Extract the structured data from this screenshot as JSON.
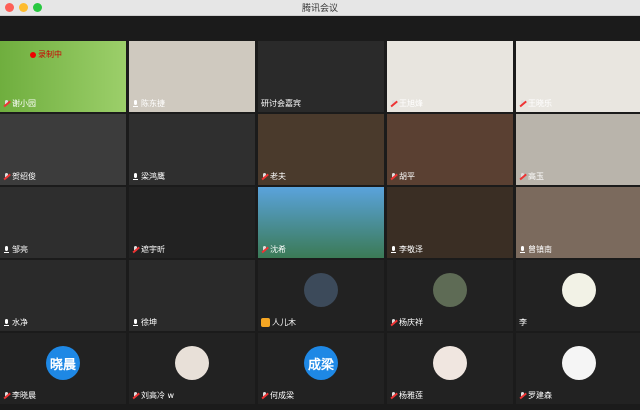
{
  "window": {
    "title": "腾讯会议"
  },
  "recording": {
    "label": "录制中"
  },
  "participants": [
    {
      "name": "谢小园",
      "mic": "off",
      "badge": false
    },
    {
      "name": "陈东捷",
      "mic": "on",
      "badge": false
    },
    {
      "name": "研讨会嘉宾",
      "mic": "none",
      "badge": false
    },
    {
      "name": "王旭烽",
      "mic": "off",
      "badge": false
    },
    {
      "name": "王晓乐",
      "mic": "off",
      "badge": false
    },
    {
      "name": "贺绍俊",
      "mic": "off",
      "badge": false
    },
    {
      "name": "梁鸿鹰",
      "mic": "on",
      "badge": false
    },
    {
      "name": "老夫",
      "mic": "off",
      "badge": false
    },
    {
      "name": "胡平",
      "mic": "off",
      "badge": false
    },
    {
      "name": "高玉",
      "mic": "off",
      "badge": false
    },
    {
      "name": "邹亮",
      "mic": "on",
      "badge": false
    },
    {
      "name": "遮宇昕",
      "mic": "off",
      "badge": false
    },
    {
      "name": "沈希",
      "mic": "off",
      "badge": false
    },
    {
      "name": "李敬泽",
      "mic": "on",
      "badge": false
    },
    {
      "name": "曾镇南",
      "mic": "on",
      "badge": false
    },
    {
      "name": "水净",
      "mic": "on",
      "badge": false
    },
    {
      "name": "徐坤",
      "mic": "on",
      "badge": false
    },
    {
      "name": "人儿木",
      "mic": "none",
      "badge": true
    },
    {
      "name": "杨庆祥",
      "mic": "off",
      "badge": false
    },
    {
      "name": "李",
      "mic": "none",
      "badge": false
    },
    {
      "name": "李晓晨",
      "mic": "off",
      "badge": false
    },
    {
      "name": "刘高冷 w",
      "mic": "off",
      "badge": false
    },
    {
      "name": "何成梁",
      "mic": "off",
      "badge": false
    },
    {
      "name": "杨雅莲",
      "mic": "off",
      "badge": false
    },
    {
      "name": "罗建森",
      "mic": "off",
      "badge": false
    }
  ],
  "text_avatars": {
    "p20": "晓晨",
    "p22": "成梁"
  },
  "colors": {
    "active_speaker": "#3ecf5f",
    "tile_bg": "#222222",
    "avatar_blue": "#1e88e5"
  },
  "icons": {
    "mic_on": "mic-icon",
    "mic_off": "mic-muted-icon",
    "host": "host-badge-icon"
  }
}
